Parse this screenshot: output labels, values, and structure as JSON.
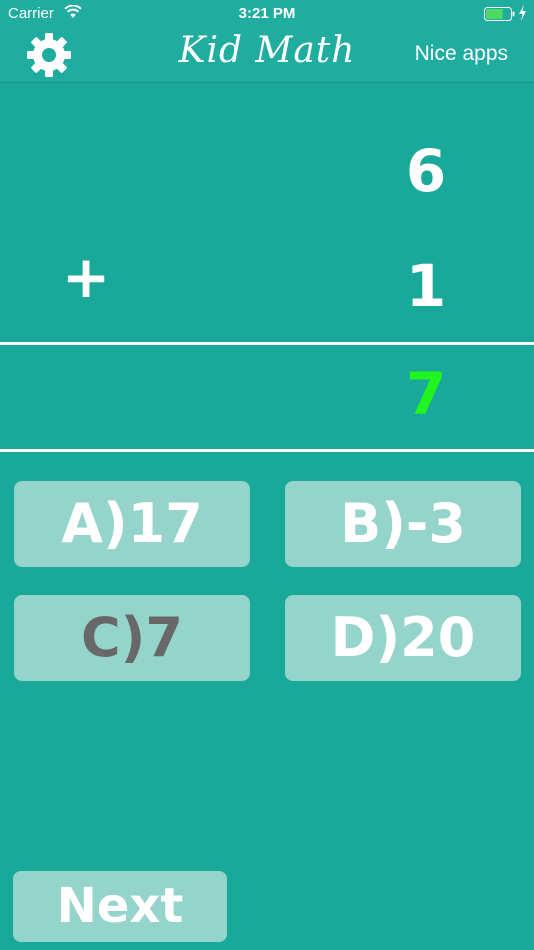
{
  "status_bar": {
    "carrier": "Carrier",
    "time": "3:21 PM",
    "wifi_icon": "wifi-icon",
    "battery_icon": "battery-icon",
    "charging_icon": "charging-icon",
    "battery_level": 0.7,
    "battery_color": "#4cd964"
  },
  "nav": {
    "title": "Kid Math",
    "right_link": "Nice apps",
    "settings_icon": "gear-icon"
  },
  "problem": {
    "top_operand": "6",
    "operator": "+",
    "bottom_operand": "1",
    "answer": "7",
    "answer_color": "#21f41f"
  },
  "choices": [
    {
      "label": "A)17"
    },
    {
      "label": "B)-3"
    },
    {
      "label": "C)7",
      "selected": true,
      "color": "#686868"
    },
    {
      "label": "D)20"
    }
  ],
  "next_label": "Next",
  "colors": {
    "background": "#18a99a",
    "button_fill": "#95d4ca",
    "text": "#ffffff"
  }
}
